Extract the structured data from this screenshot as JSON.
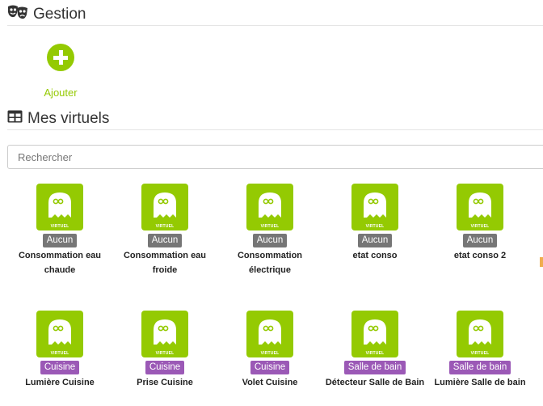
{
  "gestion": {
    "title": "Gestion",
    "add_label": "Ajouter"
  },
  "virtuels": {
    "title": "Mes virtuels",
    "search_placeholder": "Rechercher",
    "tile_caption": "VIRTUEL",
    "items": [
      {
        "badge": "Aucun",
        "name": "Consommation eau chaude"
      },
      {
        "badge": "Aucun",
        "name": "Consommation eau froide"
      },
      {
        "badge": "Aucun",
        "name": "Consommation électrique"
      },
      {
        "badge": "Aucun",
        "name": "etat conso"
      },
      {
        "badge": "Aucun",
        "name": "etat conso 2"
      },
      {
        "badge": "Cuisine",
        "name": "Lumière Cuisine"
      },
      {
        "badge": "Cuisine",
        "name": "Prise Cuisine"
      },
      {
        "badge": "Cuisine",
        "name": "Volet Cuisine"
      },
      {
        "badge": "Salle de bain",
        "name": "Détecteur Salle de Bain"
      },
      {
        "badge": "Salle de bain",
        "name": "Lumière Salle de bain"
      }
    ]
  },
  "colors": {
    "accent": "#94ca02",
    "badge_none": "#767676",
    "badge_room": "#9b59b6"
  }
}
